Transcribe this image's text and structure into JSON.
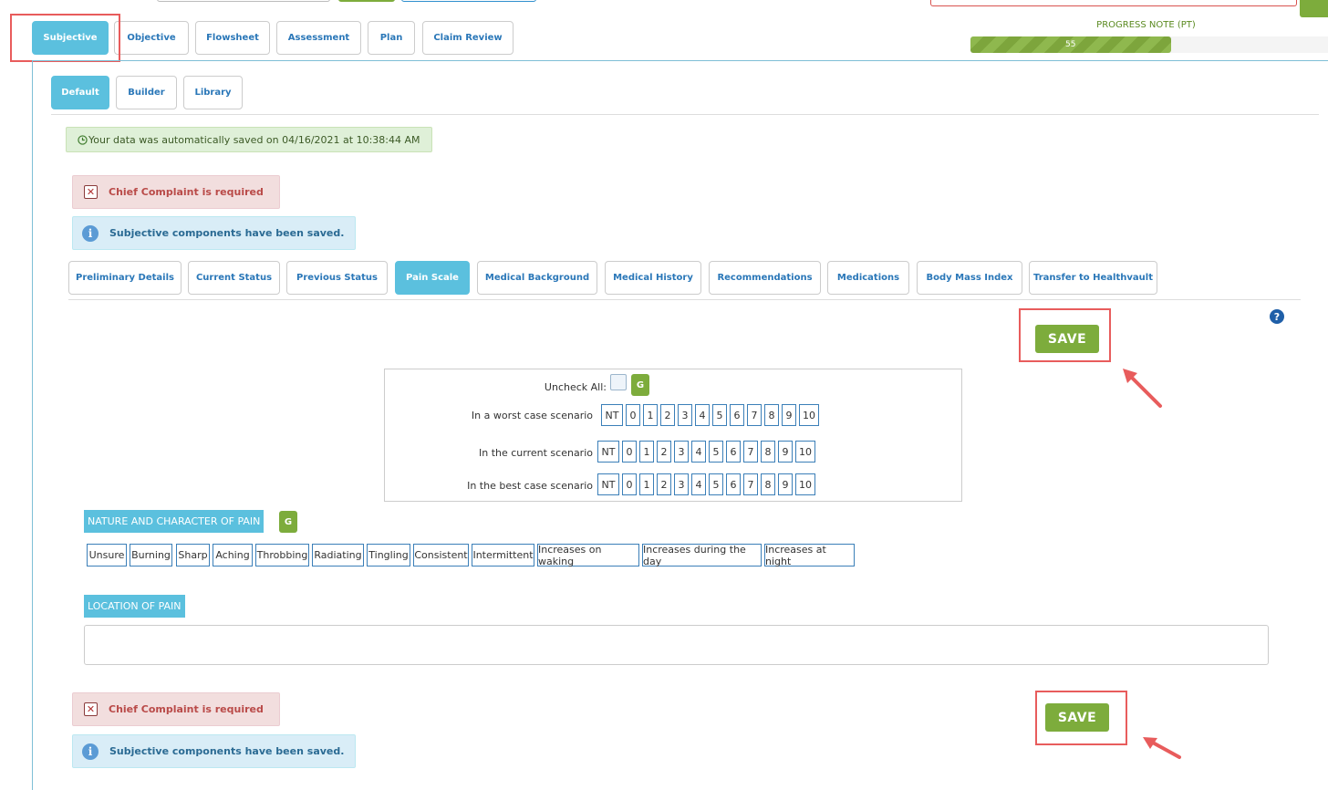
{
  "main_tabs": [
    {
      "label": "Subjective",
      "active": true
    },
    {
      "label": "Objective",
      "active": false
    },
    {
      "label": "Flowsheet",
      "active": false
    },
    {
      "label": "Assessment",
      "active": false
    },
    {
      "label": "Plan",
      "active": false
    },
    {
      "label": "Claim Review",
      "active": false
    }
  ],
  "progress": {
    "label": "PROGRESS NOTE (PT)",
    "value": 55,
    "percent": 56
  },
  "view_tabs": [
    {
      "label": "Default",
      "active": true
    },
    {
      "label": "Builder",
      "active": false
    },
    {
      "label": "Library",
      "active": false
    }
  ],
  "autosave_message": "Your data was automatically saved on 04/16/2021 at 10:38:44 AM",
  "alerts": {
    "error": "Chief Complaint is required",
    "info": "Subjective components have been saved."
  },
  "section_tabs": [
    {
      "label": "Preliminary Details",
      "active": false
    },
    {
      "label": "Current Status",
      "active": false
    },
    {
      "label": "Previous Status",
      "active": false
    },
    {
      "label": "Pain Scale",
      "active": true
    },
    {
      "label": "Medical Background",
      "active": false
    },
    {
      "label": "Medical History",
      "active": false
    },
    {
      "label": "Recommendations",
      "active": false
    },
    {
      "label": "Medications",
      "active": false
    },
    {
      "label": "Body Mass Index",
      "active": false
    },
    {
      "label": "Transfer to Healthvault",
      "active": false
    }
  ],
  "help_icon": "?",
  "save_label": "SAVE",
  "pain_scale": {
    "uncheck_all_label": "Uncheck All:",
    "g_label": "G",
    "rows": [
      {
        "label": "In a worst case scenario"
      },
      {
        "label": "In the current scenario"
      },
      {
        "label": "In the best case scenario"
      }
    ],
    "options": [
      "NT",
      "0",
      "1",
      "2",
      "3",
      "4",
      "5",
      "6",
      "7",
      "8",
      "9",
      "10"
    ]
  },
  "nature_of_pain": {
    "title": "NATURE AND CHARACTER OF PAIN",
    "g_label": "G",
    "options": [
      "Unsure",
      "Burning",
      "Sharp",
      "Aching",
      "Throbbing",
      "Radiating",
      "Tingling",
      "Consistent",
      "Intermittent",
      "Increases on waking",
      "Increases during the day",
      "Increases at night"
    ]
  },
  "location_of_pain": {
    "title": "LOCATION OF PAIN",
    "value": ""
  },
  "colors": {
    "accent": "#5bc0de",
    "link": "#2a77b8",
    "save": "#7dac3c",
    "annotation": "#e85c5c"
  }
}
